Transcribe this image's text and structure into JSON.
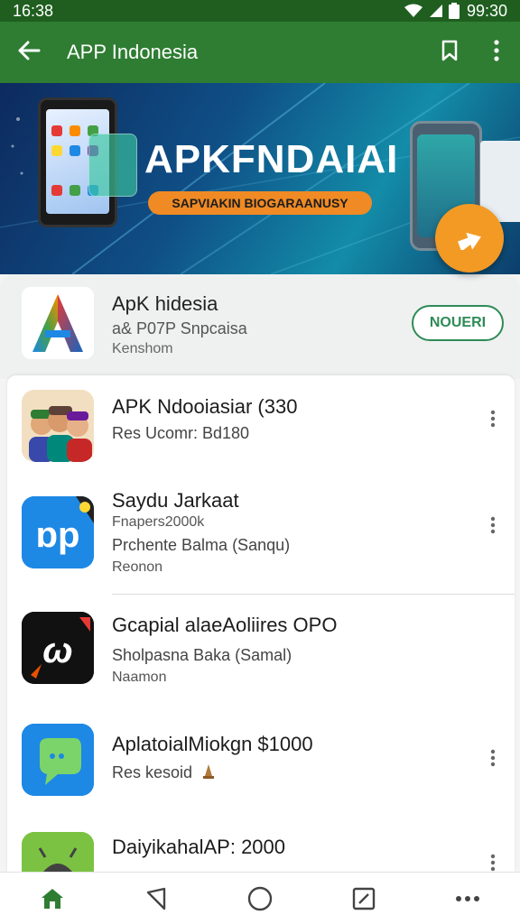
{
  "status_bar": {
    "time": "16:38",
    "right_time": "99:30",
    "icons": [
      "wifi-icon",
      "signal-icon",
      "battery-icon"
    ]
  },
  "app_bar": {
    "title": "APP Indonesia",
    "icons": [
      "back-arrow-icon",
      "bookmark-icon",
      "more-vert-icon"
    ]
  },
  "banner": {
    "title": "APKFNDAIAI",
    "subtitle": "SAPVIAKIN BIOGARAANUSY",
    "fab_icon": "share-arrow-icon"
  },
  "featured": {
    "name": "ApK hidesia",
    "subtitle": "a& P07P Snpcaisa",
    "developer": "Kenshom",
    "action_label": "NOUERI"
  },
  "apps": [
    {
      "name": "APK Ndooiasiar (330",
      "line1": "Res Ucomr: Bd180",
      "line2": "",
      "line3": "",
      "icon": "people-avatars-icon"
    },
    {
      "name": "Saydu Jarkaat",
      "line1": "Fnapers2000k",
      "line2": "Prchente Balma (Sanqu)",
      "line3": "Reonon",
      "icon": "blue-app-logo-icon"
    },
    {
      "name": "Gcapial alaeAoliires OPO",
      "line1": "Sholpasna Baka (Samal)",
      "line2": "Naamon",
      "line3": "",
      "icon": "black-app-logo-icon"
    },
    {
      "name": "AplatoialMiokgn $1000",
      "line1": "Res kesoid",
      "line2": "",
      "line3": "",
      "icon": "chat-bubble-icon"
    },
    {
      "name": "DaiyikahalAP: 2000",
      "line1": "",
      "line2": "",
      "line3": "",
      "icon": "android-icon"
    }
  ],
  "bottom_nav": [
    "home-icon",
    "back-triangle-icon",
    "circle-home-icon",
    "edit-square-icon",
    "more-horiz-icon"
  ],
  "colors": {
    "primary": "#2e7d32",
    "status": "#1f5e1f",
    "accent": "#f39a24",
    "install": "#2e8b57"
  }
}
